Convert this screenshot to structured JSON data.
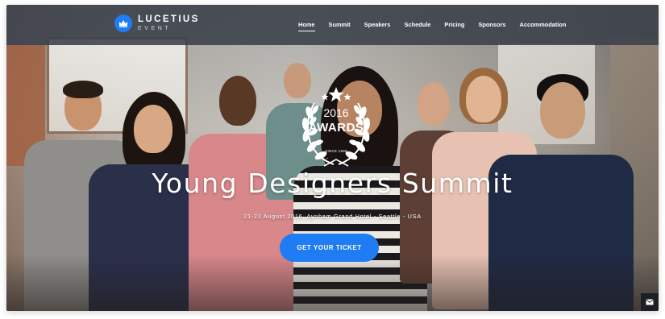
{
  "brand": {
    "name": "LUCETIUS",
    "tagline": "EVENT",
    "logo_icon": "crown-icon",
    "accent": "#1f7cf2"
  },
  "nav": {
    "items": [
      {
        "label": "Home",
        "active": true
      },
      {
        "label": "Summit",
        "active": false
      },
      {
        "label": "Speakers",
        "active": false
      },
      {
        "label": "Schedule",
        "active": false
      },
      {
        "label": "Pricing",
        "active": false
      },
      {
        "label": "Sponsors",
        "active": false
      },
      {
        "label": "Accommodation",
        "active": false
      }
    ]
  },
  "badge": {
    "year": "2016",
    "title": "AWARDS",
    "since": "SINCE 1988",
    "icon": "laurel-wreath-icon"
  },
  "hero": {
    "title": "Young Designers Summit",
    "subtitle": "21-22 August 2016, Aynham Grand Hotel - Seattle - USA",
    "cta_label": "GET YOUR TICKET"
  },
  "corner": {
    "icon": "mail-icon"
  }
}
